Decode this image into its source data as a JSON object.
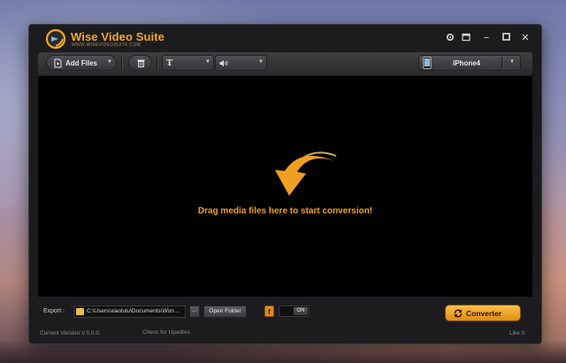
{
  "app": {
    "title": "Wise Video Suite",
    "subtitle": "WWW.WISEVIDEOSUITE.COM",
    "brand_color": "#f5a623"
  },
  "window_controls": {
    "settings_icon": "gear-icon",
    "skin_icon": "skin-icon",
    "minimize": "−",
    "maximize": "□",
    "close": "✕"
  },
  "toolbar": {
    "add_files_label": "Add Files",
    "text_button_label": "T",
    "profile_device": "iPhone4"
  },
  "dropzone": {
    "message": "Drag media files here to start conversion!",
    "accent_color": "#f0a020"
  },
  "bottom": {
    "export_label": "Export :",
    "export_path": "C:\\Users\\xiaolulu\\Documents\\Won...",
    "browse_label": "...",
    "open_folder_label": "Open Folder",
    "toggle_label": "ON",
    "convert_label": "Converter"
  },
  "footer": {
    "version": "Current Version:V.5.0.0.",
    "check_updates": "Check for Upadtes",
    "like": "Like It"
  }
}
